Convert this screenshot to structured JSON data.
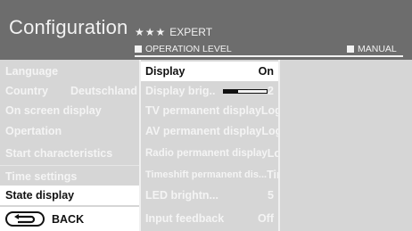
{
  "header": {
    "title": "Configuration",
    "stars": "★★★",
    "level_name": "EXPERT",
    "operation_level": "OPERATION LEVEL",
    "manual": "MANUAL"
  },
  "menu": {
    "items": [
      {
        "label": "Language",
        "value": ""
      },
      {
        "label": "Country",
        "value": "Deutschland"
      },
      {
        "label": "On screen display",
        "value": ""
      },
      {
        "label": "Opertation",
        "value": ""
      },
      {
        "label": "Start characteristics",
        "value": ""
      },
      {
        "label": "Time settings",
        "value": ""
      },
      {
        "label": "State display",
        "value": ""
      }
    ],
    "back_label": "BACK"
  },
  "submenu": {
    "items": [
      {
        "label": "Display",
        "value": "On"
      },
      {
        "label": "Display brig..",
        "value": "2",
        "slider_level": 0.33
      },
      {
        "label": "TV permanent display",
        "value": "Logo"
      },
      {
        "label": "AV permanent display",
        "value": "Logo"
      },
      {
        "label": "Radio permanent display",
        "value": "Logo"
      },
      {
        "label": "Timeshift permanent dis...",
        "value": "Time"
      },
      {
        "label": "LED brightn...",
        "value": "5"
      },
      {
        "label": "Input feedback",
        "value": "Off"
      }
    ]
  },
  "colors": {
    "header_bg": "#6d6d6d",
    "panel_bg": "#d6d6d6",
    "highlight": "#ffffff",
    "text_light": "#f4f4f4",
    "text_dark": "#111111"
  }
}
